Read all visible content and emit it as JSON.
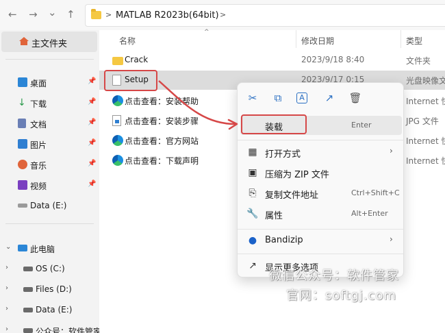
{
  "nav": {
    "back": "←",
    "forward": "→",
    "dropdown": "⌄",
    "up": "↑",
    "path_sep": ">",
    "path": "MATLAB R2023b(64bit)"
  },
  "sidebar": {
    "home": "主文件夹",
    "pinned": [
      {
        "label": "桌面",
        "icon": "desktop-icon",
        "color": "#2b86d6"
      },
      {
        "label": "下载",
        "icon": "download-icon",
        "color": "#2b9a4b"
      },
      {
        "label": "文档",
        "icon": "document-icon",
        "color": "#6a7fb5"
      },
      {
        "label": "图片",
        "icon": "pictures-icon",
        "color": "#2f7fd1"
      },
      {
        "label": "音乐",
        "icon": "music-icon",
        "color": "#e0643a"
      },
      {
        "label": "视频",
        "icon": "video-icon",
        "color": "#7a3fc0"
      },
      {
        "label": "Data (E:)",
        "icon": "drive-icon",
        "color": "#555555"
      }
    ],
    "pin_glyph": "📌",
    "this_pc": "此电脑",
    "drives": [
      {
        "label": "OS (C:)",
        "icon": "os-drive-icon"
      },
      {
        "label": "Files (D:)",
        "icon": "drive-icon"
      },
      {
        "label": "Data (E:)",
        "icon": "drive-icon"
      },
      {
        "label": "公众号：软件管家",
        "icon": "drive-icon"
      }
    ],
    "expand_glyph": "›",
    "collapse_glyph": "⌄"
  },
  "columns": {
    "name": "名称",
    "date": "修改日期",
    "type": "类型",
    "sort_glyph": "^"
  },
  "files": [
    {
      "name": "Crack",
      "date": "2023/9/18 8:40",
      "type": "文件夹",
      "icon": "folder"
    },
    {
      "name": "Setup",
      "date": "2023/9/17 0:15",
      "type": "光盘映像文",
      "icon": "disc-image"
    },
    {
      "name": "点击查看：安装帮助",
      "date": "",
      "type": "Internet 快",
      "icon": "edge"
    },
    {
      "name": "点击查看：安装步骤",
      "date": "",
      "type": "JPG 文件",
      "icon": "jpg"
    },
    {
      "name": "点击查看：官方网站",
      "date": "",
      "type": "Internet 快",
      "icon": "edge"
    },
    {
      "name": "点击查看：下载声明",
      "date": "",
      "type": "Internet 快",
      "icon": "edge"
    }
  ],
  "context_menu": {
    "quick_actions": [
      {
        "glyph": "✂",
        "icon": "cut-icon"
      },
      {
        "glyph": "⧉",
        "icon": "copy-icon"
      },
      {
        "glyph": "A",
        "icon": "rename-icon"
      },
      {
        "glyph": "↗",
        "icon": "share-icon"
      },
      {
        "glyph": "🗑",
        "icon": "delete-icon"
      }
    ],
    "mount": {
      "label": "装载",
      "accel": "Enter",
      "glyph": ""
    },
    "open_with": {
      "label": "打开方式",
      "glyph": "▦",
      "sub": "›"
    },
    "compress_zip": {
      "label": "压缩为 ZIP 文件",
      "glyph": "▣"
    },
    "copy_path": {
      "label": "复制文件地址",
      "accel": "Ctrl+Shift+C",
      "glyph": "⎘"
    },
    "properties": {
      "label": "属性",
      "accel": "Alt+Enter",
      "glyph": "🔧"
    },
    "bandizip": {
      "label": "Bandizip",
      "glyph": "●",
      "sub": "›"
    },
    "more": {
      "label": "显示更多选项",
      "glyph": "↗"
    }
  },
  "watermark": {
    "line1": "微信公众号：软件管家",
    "line2": "官网：softgj.com"
  },
  "colors": {
    "annotation_red": "#d64747",
    "selection": "#dcdcdc",
    "accent": "#2a6fc2"
  }
}
